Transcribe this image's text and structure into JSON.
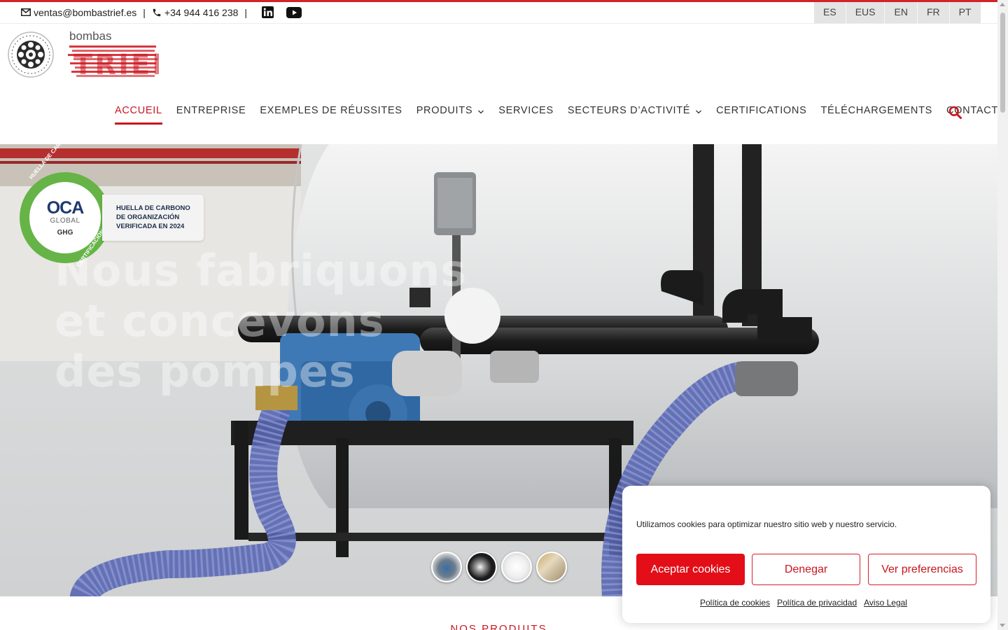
{
  "topbar": {
    "email": "ventas@bombastrief.es",
    "phone": "+34 944 416 238",
    "separator": "|",
    "social": [
      "linkedin-icon",
      "youtube-icon"
    ],
    "languages": [
      "ES",
      "EUS",
      "EN",
      "FR",
      "PT"
    ]
  },
  "logo": {
    "word": "bombas",
    "brand": "TRIEF"
  },
  "nav": {
    "items": [
      {
        "label": "ACCUEIL",
        "active": true
      },
      {
        "label": "ENTREPRISE"
      },
      {
        "label": "EXEMPLES DE RÉUSSITES"
      },
      {
        "label": "PRODUITS",
        "dropdown": true
      },
      {
        "label": "SERVICES"
      },
      {
        "label": "SECTEURS D’ACTIVITÉ",
        "dropdown": true
      },
      {
        "label": "CERTIFICATIONS"
      },
      {
        "label": "TÉLÉCHARGEMENTS"
      },
      {
        "label": "CONTACT"
      }
    ],
    "search_icon": "search-icon"
  },
  "hero": {
    "title": "Nous fabriquons et concevons des pompes",
    "badge": {
      "oca": "OCA",
      "global": "GLOBAL",
      "ghg": "GHG",
      "ring_top": "HUELLA DE CARBONO",
      "ring_bottom": "CERTIFICACIÓN",
      "line1": "HUELLA DE CARBONO",
      "line2": "DE ORGANIZACIÓN",
      "line3": "VERIFICADA EN 2024"
    },
    "slides": 4
  },
  "products_heading": "NOS PRODUITS",
  "cookie": {
    "message": "Utilizamos cookies para optimizar nuestro sitio web y nuestro servicio.",
    "accept": "Aceptar cookies",
    "deny": "Denegar",
    "preferences": "Ver preferencias",
    "links": [
      "Política de cookies",
      "Política de privacidad",
      "Aviso Legal"
    ]
  },
  "colors": {
    "accent": "#c8161e",
    "accept_bg": "#e30e17",
    "badge_green": "#66b447"
  }
}
